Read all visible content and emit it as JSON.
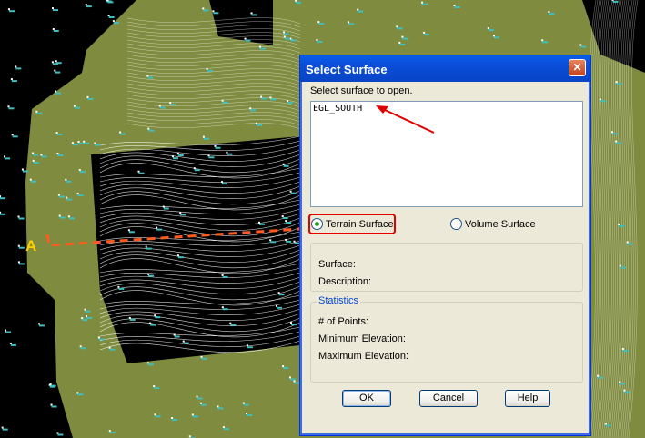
{
  "callout": {
    "label": "A"
  },
  "dialog": {
    "title": "Select Surface",
    "close_label": "✕",
    "prompt": "Select surface to open.",
    "surfaces": [
      "EGL_SOUTH"
    ],
    "radio_options": [
      {
        "label": "Terrain Surface",
        "selected": true
      },
      {
        "label": "Volume Surface",
        "selected": false
      }
    ],
    "info": {
      "surface_label": "Surface:",
      "description_label": "Description:"
    },
    "statistics": {
      "caption": "Statistics",
      "points_label": "# of Points:",
      "min_elev_label": "Minimum Elevation:",
      "max_elev_label": "Maximum Elevation:"
    },
    "buttons": {
      "ok": "OK",
      "cancel": "Cancel",
      "help": "Help"
    }
  },
  "colors": {
    "terrain": "#7f8b3f",
    "contour": "#ffffff",
    "markers": "#3dbfbf",
    "annotation": "#e00000",
    "dashed_line": "#ff5a1f",
    "callout": "#ffd000"
  }
}
